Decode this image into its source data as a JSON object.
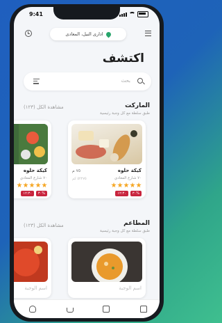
{
  "status_bar": {
    "time": "9:41"
  },
  "header": {
    "location": "ادارى النيل، المعادى",
    "title": "اكتشف"
  },
  "search": {
    "placeholder": "بحث"
  },
  "market": {
    "title": "الماركت",
    "subtitle": "طبق سلطة مع كل وجبة رئيسية",
    "see_all": "مشاهدة الكل (١٢٣)",
    "cards": [
      {
        "name": "كيكة حلوه",
        "address": "٧٠ شارع المعادي",
        "price": "٧٥ م",
        "distance": "٥٢٢٧٥ كم",
        "rating": 5,
        "badges": [
          "١٢:٣٠",
          "٣٠%"
        ]
      },
      {
        "name": "كيكة حلوه",
        "address": "٧٠ شارع المعادي",
        "rating": 5,
        "badges": [
          "١٢:٣٠",
          "٣٠%"
        ]
      }
    ]
  },
  "restaurants": {
    "title": "المطاعم",
    "subtitle": "طبق سلطة مع كل وجبة رئيسية",
    "see_all": "مشاهدة الكل (١٢٣)",
    "cards": [
      {
        "name": "اسم الوجبة"
      },
      {
        "name": "اسم الوجبة"
      }
    ]
  },
  "bottom_nav": {
    "items": [
      "home-icon",
      "bag-icon",
      "basket-icon",
      "user-icon"
    ]
  },
  "colors": {
    "accent": "#27a56b",
    "badge": "#c8243d",
    "star": "#f5a623"
  }
}
